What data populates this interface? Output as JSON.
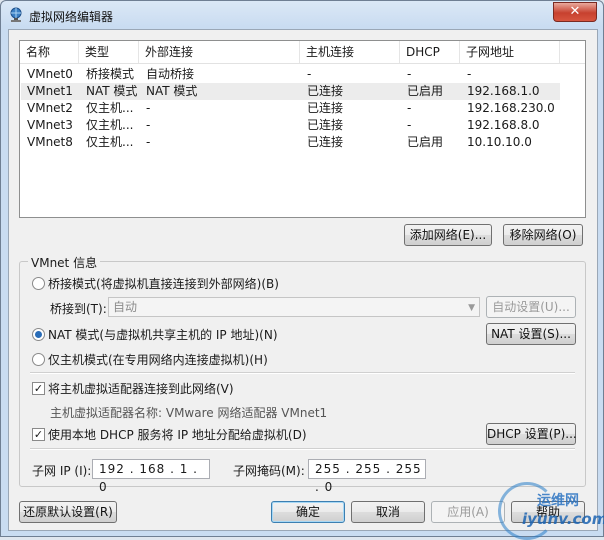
{
  "window": {
    "title": "虚拟网络编辑器",
    "close_label": "✕"
  },
  "list": {
    "columns": [
      "名称",
      "类型",
      "外部连接",
      "主机连接",
      "DHCP",
      "子网地址"
    ],
    "rows": [
      {
        "name": "VMnet0",
        "type": "桥接模式",
        "external": "自动桥接",
        "host": "-",
        "dhcp": "-",
        "subnet": "-"
      },
      {
        "name": "VMnet1",
        "type": "NAT 模式",
        "external": "NAT 模式",
        "host": "已连接",
        "dhcp": "已启用",
        "subnet": "192.168.1.0"
      },
      {
        "name": "VMnet2",
        "type": "仅主机...",
        "external": "-",
        "host": "已连接",
        "dhcp": "-",
        "subnet": "192.168.230.0"
      },
      {
        "name": "VMnet3",
        "type": "仅主机...",
        "external": "-",
        "host": "已连接",
        "dhcp": "-",
        "subnet": "192.168.8.0"
      },
      {
        "name": "VMnet8",
        "type": "仅主机...",
        "external": "-",
        "host": "已连接",
        "dhcp": "已启用",
        "subnet": "10.10.10.0"
      }
    ]
  },
  "list_buttons": {
    "add": "添加网络(E)...",
    "remove": "移除网络(O)"
  },
  "vmnet_info": {
    "title": "VMnet 信息",
    "bridge_radio": "桥接模式(将虚拟机直接连接到外部网络)(B)",
    "bridge_to_label": "桥接到(T):",
    "bridge_to_value": "自动",
    "auto_settings": "自动设置(U)...",
    "nat_radio": "NAT 模式(与虚拟机共享主机的 IP 地址)(N)",
    "nat_settings": "NAT 设置(S)...",
    "hostonly_radio": "仅主机模式(在专用网络内连接虚拟机)(H)",
    "connect_adapter_check": "将主机虚拟适配器连接到此网络(V)",
    "adapter_name_text": "主机虚拟适配器名称: VMware 网络适配器 VMnet1",
    "dhcp_check": "使用本地 DHCP 服务将 IP 地址分配给虚拟机(D)",
    "dhcp_settings": "DHCP 设置(P)...",
    "subnet_ip_label": "子网 IP (I):",
    "subnet_ip_value": "192 . 168 .  1  .  0",
    "subnet_mask_label": "子网掩码(M):",
    "subnet_mask_value": "255 . 255 . 255 .  0",
    "selected_mode": "nat",
    "connect_adapter_checked": true,
    "dhcp_checked": true
  },
  "footer": {
    "restore": "还原默认设置(R)",
    "ok": "确定",
    "cancel": "取消",
    "apply": "应用(A)",
    "help": "帮助"
  },
  "watermark": {
    "line1": "运维网",
    "line2": "iyunv.com"
  }
}
